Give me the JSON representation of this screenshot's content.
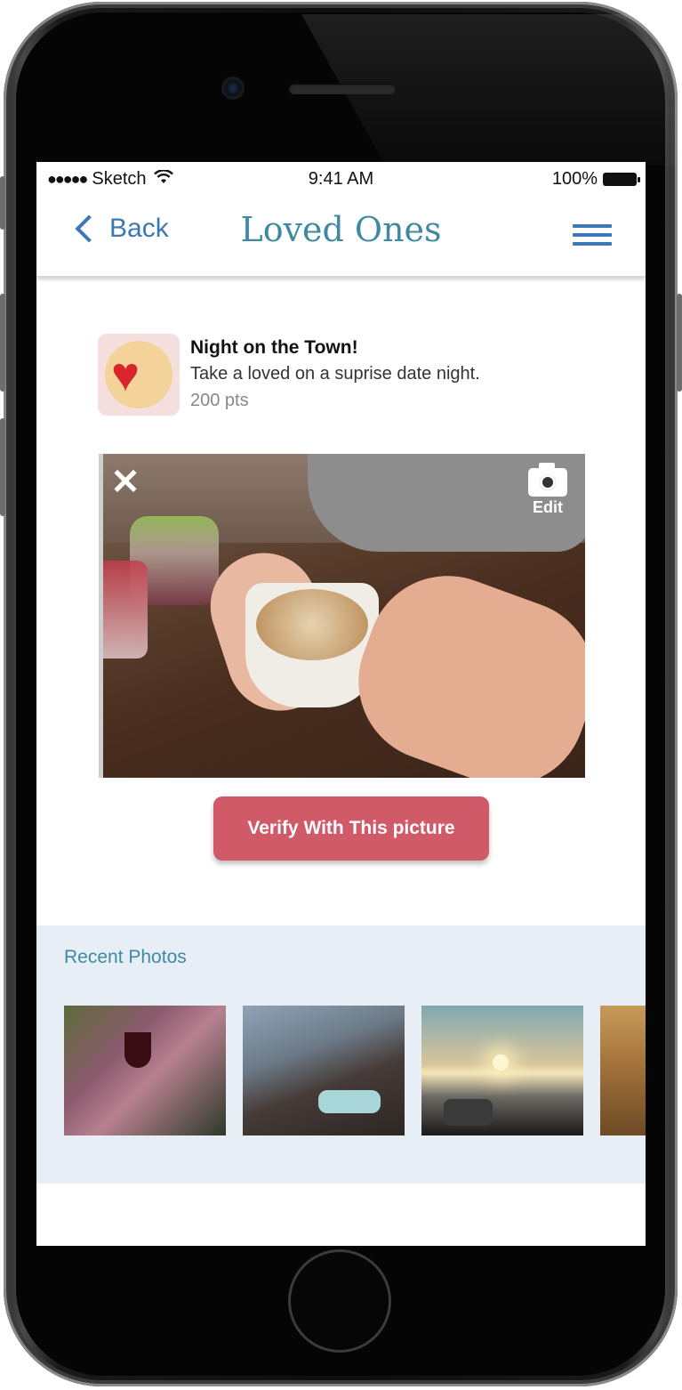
{
  "status_bar": {
    "carrier": "Sketch",
    "signal_dots": "●●●●●",
    "time": "9:41 AM",
    "battery": "100%"
  },
  "nav": {
    "back_label": "Back",
    "title": "Loved Ones"
  },
  "task": {
    "name": "Night on the Town!",
    "description": "Take a loved on a suprise date night.",
    "points": "200 pts"
  },
  "photo_actions": {
    "close_glyph": "✕",
    "edit_label": "Edit"
  },
  "verify_button": {
    "label": "Verify With This picture"
  },
  "recent_photos": {
    "title": "Recent Photos",
    "items": [
      {
        "label": "picnic wine"
      },
      {
        "label": "sneakers"
      },
      {
        "label": "sunset drive"
      },
      {
        "label": "wheat field"
      }
    ]
  },
  "icons": [
    "back-chevron-icon",
    "menu-icon",
    "heart-icon",
    "close-icon",
    "camera-icon",
    "wifi-icon",
    "battery-icon"
  ],
  "colors": {
    "accent": "#3b78b5",
    "title": "#3f8aa2",
    "button": "#d05a68",
    "recent_bg": "#e7eef5"
  }
}
